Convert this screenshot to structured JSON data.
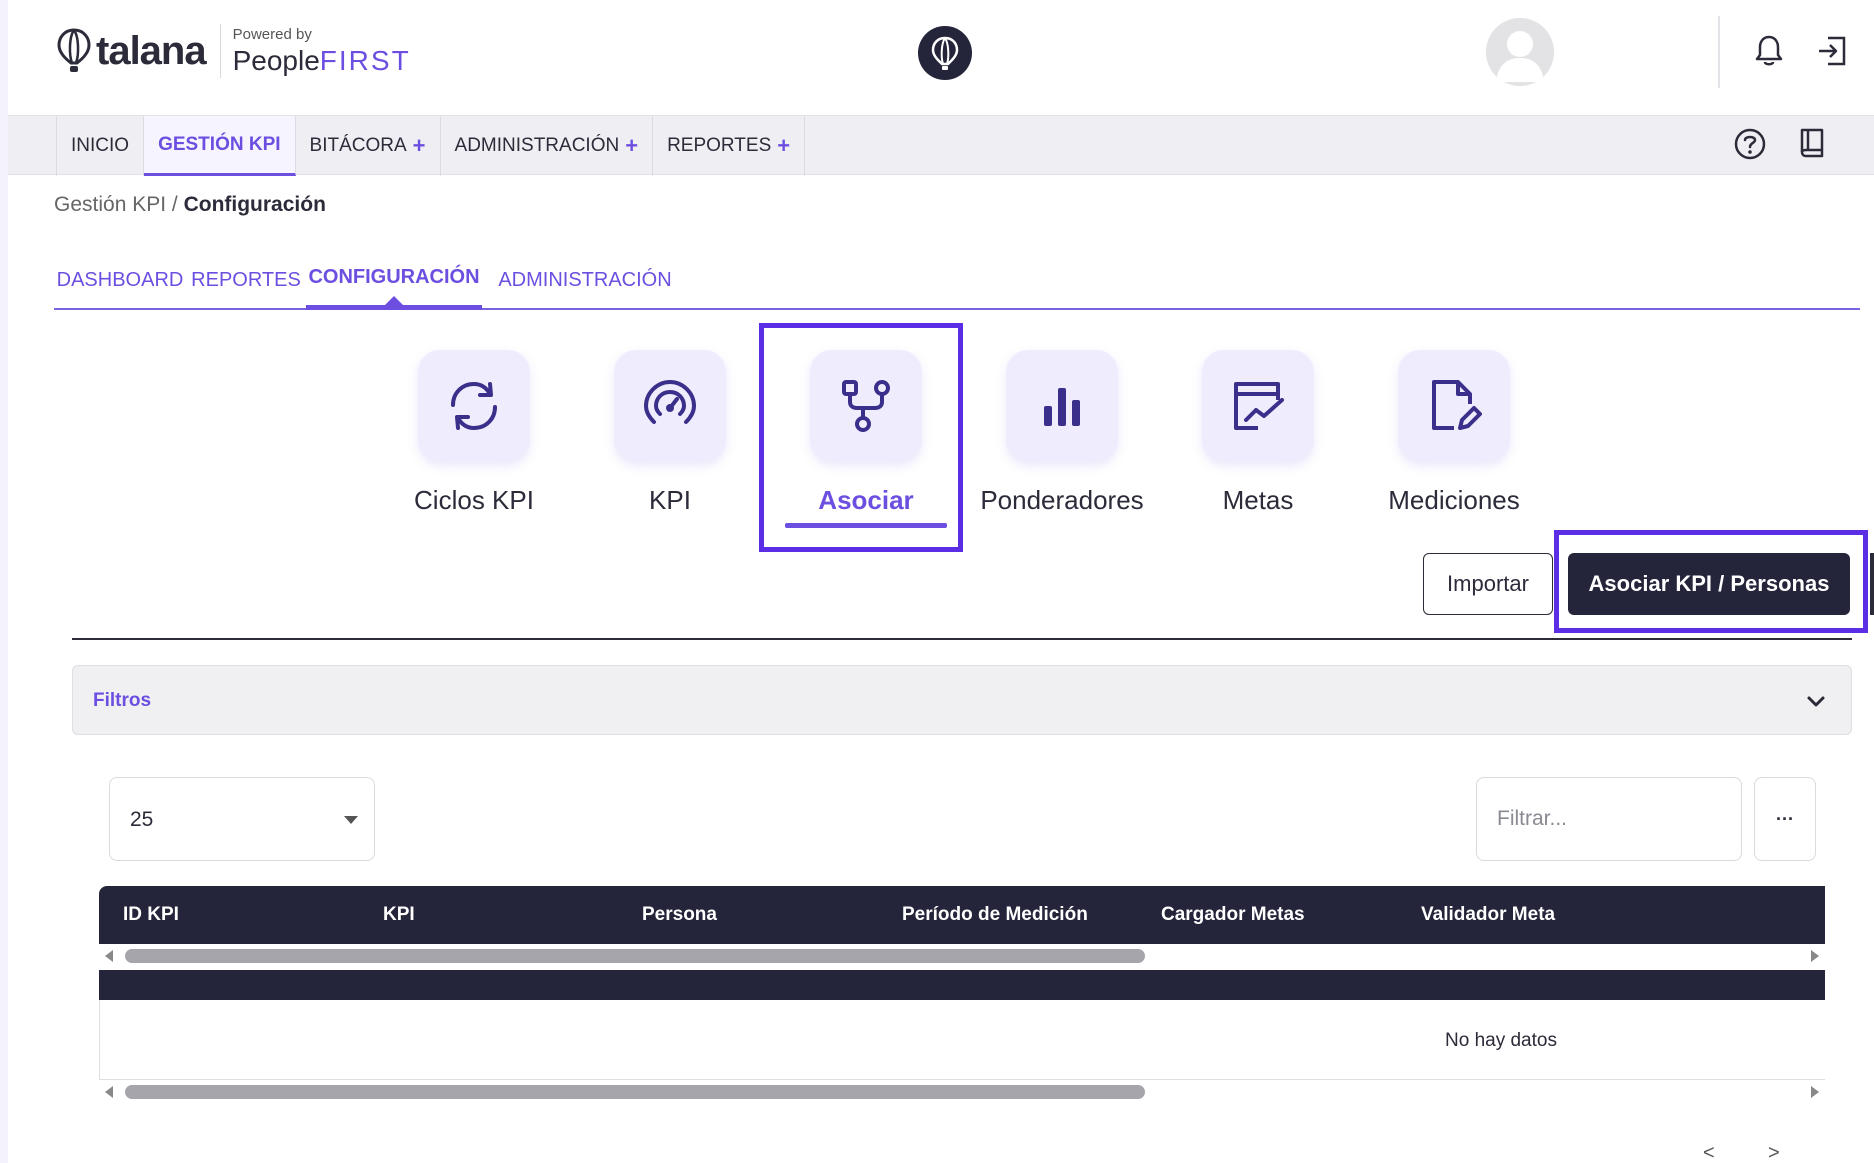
{
  "header": {
    "logo_text": "talana",
    "powered_by": "Powered by",
    "powered_brand_main": "People",
    "powered_brand_accent": "FIRST"
  },
  "topnav": {
    "items": [
      {
        "label": "INICIO"
      },
      {
        "label": "GESTIÓN KPI"
      },
      {
        "label": "BITÁCORA"
      },
      {
        "label": "ADMINISTRACIÓN"
      },
      {
        "label": "REPORTES"
      }
    ],
    "plus_symbol": "+"
  },
  "breadcrumb": {
    "parent": "Gestión KPI",
    "separator": " / ",
    "current": "Configuración"
  },
  "subtabs": [
    {
      "label": "DASHBOARD"
    },
    {
      "label": "REPORTES"
    },
    {
      "label": "CONFIGURACIÓN"
    },
    {
      "label": "ADMINISTRACIÓN"
    }
  ],
  "cards": [
    {
      "label": "Ciclos KPI",
      "icon": "refresh-cycle-icon"
    },
    {
      "label": "KPI",
      "icon": "gauge-icon"
    },
    {
      "label": "Asociar",
      "icon": "branch-associate-icon"
    },
    {
      "label": "Ponderadores",
      "icon": "bar-chart-icon"
    },
    {
      "label": "Metas",
      "icon": "trend-chart-icon"
    },
    {
      "label": "Mediciones",
      "icon": "document-edit-icon"
    }
  ],
  "actions": {
    "import_label": "Importar",
    "associate_label": "Asociar KPI / Personas"
  },
  "filters": {
    "label": "Filtros"
  },
  "table": {
    "page_size": "25",
    "filter_placeholder": "Filtrar...",
    "more_label": "···",
    "columns": [
      "ID KPI",
      "KPI",
      "Persona",
      "Período de Medición",
      "Cargador Metas",
      "Validador Meta"
    ],
    "empty_message": "No hay datos"
  },
  "pagination": {
    "prev": "<",
    "next": ">"
  },
  "colors": {
    "accent": "#6c4fe0",
    "dark": "#24243a",
    "highlight": "#5b2ee6",
    "icon_bg": "#efecfd"
  }
}
